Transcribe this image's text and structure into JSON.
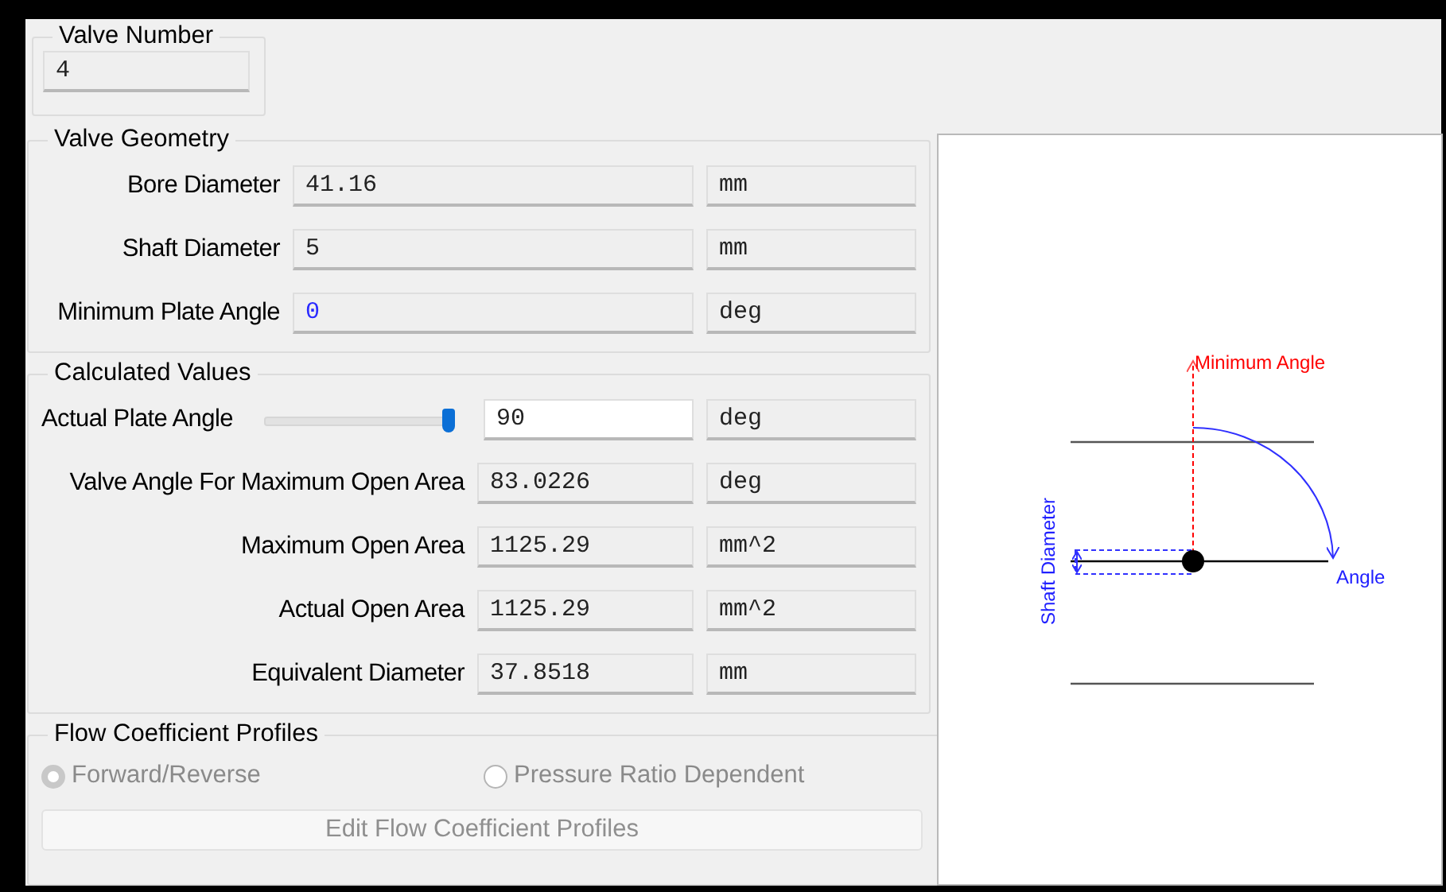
{
  "valve_number": {
    "title": "Valve Number",
    "value": "4"
  },
  "valve_geometry": {
    "title": "Valve Geometry",
    "rows": [
      {
        "kind": "readonly",
        "label": "Bore Diameter",
        "value": "41.16",
        "unit": "mm"
      },
      {
        "kind": "readonly",
        "label": "Shaft Diameter",
        "value": "5",
        "unit": "mm"
      },
      {
        "kind": "numeric",
        "label": "Minimum Plate Angle",
        "value": "0",
        "unit": "deg"
      }
    ]
  },
  "calculated_values": {
    "title": "Calculated Values",
    "rows": [
      {
        "kind": "slider",
        "label": "Actual Plate Angle",
        "level": 1,
        "value": "90",
        "unit": "deg"
      },
      {
        "kind": "readonly",
        "label": "Valve Angle For Maximum Open Area",
        "value": "83.0226",
        "unit": "deg"
      },
      {
        "kind": "readonly",
        "label": "Maximum Open Area",
        "value": "1125.29",
        "unit": "mm^2"
      },
      {
        "kind": "readonly",
        "label": "Actual Open Area",
        "value": "1125.29",
        "unit": "mm^2"
      },
      {
        "kind": "readonly",
        "label": "Equivalent Diameter",
        "value": "37.8518",
        "unit": "mm"
      }
    ]
  },
  "flow_coefficient_profiles": {
    "title": "Flow Coefficient Profiles",
    "options": [
      {
        "label": "Forward/Reverse",
        "selected": true,
        "disabled": true
      },
      {
        "label": "Pressure Ratio Dependent",
        "selected": false,
        "disabled": true
      }
    ],
    "button": {
      "label": "Edit Flow Coefficient Profiles",
      "disabled": true
    }
  },
  "diagram": {
    "minimum_angle_label": "Minimum Angle",
    "angle_label": "Angle",
    "shaft_label": "Shaft Diameter"
  }
}
